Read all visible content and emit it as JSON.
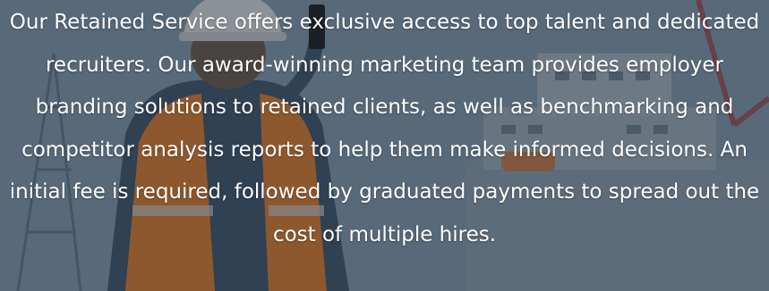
{
  "hero": {
    "background_image": "worker-at-shipyard-photo",
    "paragraph": "Our Retained Service offers exclusive access to top talent and dedicated recruiters. Our award-winning marketing team provides employer branding solutions to retained clients, as well as benchmarking and competitor analysis reports to help them make informed decisions. An initial fee is required, followed by graduated payments to spread out the cost of multiple hires."
  },
  "colors": {
    "text": "#ffffff",
    "vest": "#e07a2a",
    "sky": "#8aa0b0"
  }
}
